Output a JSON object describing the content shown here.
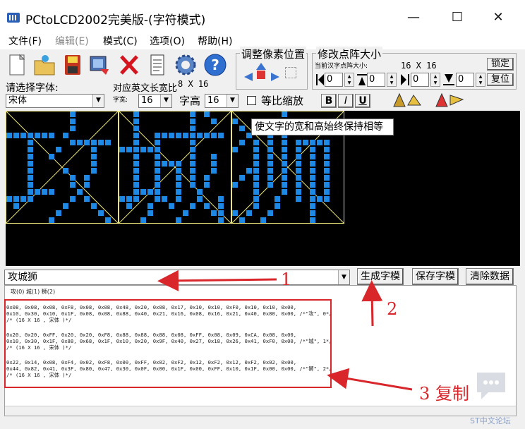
{
  "window": {
    "title": "PCtoLCD2002完美版-(字符模式)",
    "minimize": "—",
    "maximize": "☐",
    "close": "✕"
  },
  "menu": [
    "文件(F)",
    "编辑(E)",
    "模式(C)",
    "选项(O)",
    "帮助(H)"
  ],
  "toolbar": {
    "adjust_title": "调整像素位置",
    "modify_title": "修改点阵大小",
    "current_size_label": "当前汉字点阵大小:",
    "current_size_value": "16 X 16",
    "lock_button": "锁定",
    "restore_button": "复位",
    "spin_values": [
      "0",
      "0",
      "0",
      "0"
    ]
  },
  "font": {
    "select_label": "请选择字体:",
    "ratio_label": "对应英文长宽比",
    "ratio_value": "8 X 16",
    "font_name": "宋体",
    "width_label": "字宽:",
    "width_value": "16",
    "height_label": "字高",
    "height_value": "16",
    "proportional_label": "等比缩放",
    "bold": "B",
    "italic": "I",
    "underline": "U"
  },
  "tooltip": "使文字的宽和高始终保持相等",
  "input": {
    "value": "攻城狮"
  },
  "buttons": {
    "generate": "生成字模",
    "save": "保存字模",
    "clear": "清除数据"
  },
  "output": {
    "header": "攻(0) 城(1) 狮(2)",
    "blocks": [
      [
        "0x08, 0x08, 0x08, 0xF8, 0x08, 0x08, 0x48, 0x20, 0x08, 0x17, 0x10, 0x10, 0xF0, 0x10, 0x10, 0x00,",
        "0x10, 0x30, 0x10, 0x1F, 0x08, 0x08, 0x88, 0x40, 0x21, 0x16, 0x08, 0x16, 0x21, 0x40, 0x80, 0x00, /*\"攻\", 0*/",
        "/* (16 X 16 , 宋体 )*/"
      ],
      [
        "0x20, 0x20, 0xFF, 0x20, 0x20, 0xF8, 0x88, 0x88, 0x88, 0x08, 0xFF, 0x08, 0x09, 0xCA, 0x08, 0x00,",
        "0x10, 0x30, 0x1F, 0x88, 0x68, 0x1F, 0x10, 0x20, 0x9F, 0x40, 0x27, 0x18, 0x26, 0x41, 0xF0, 0x00, /*\"城\", 1*/",
        "/* (16 X 16 , 宋体 )*/"
      ],
      [
        "0x22, 0x14, 0x08, 0xF4, 0x02, 0xF8, 0x00, 0xFF, 0x02, 0xF2, 0x12, 0xF2, 0x12, 0xF2, 0x02, 0x00,",
        "0x44, 0x82, 0x41, 0x3F, 0x80, 0x47, 0x30, 0x0F, 0x00, 0x1F, 0x00, 0xFF, 0x10, 0x1F, 0x00, 0x00, /*\"狮\", 2*/",
        "/* (16 X 16 , 宋体 )*/"
      ]
    ]
  },
  "annotations": {
    "step1": "1",
    "step2": "2",
    "step3": "3 复制"
  },
  "watermark": "ST中文论坛",
  "colors": {
    "pixel": "#1e88e5",
    "grid": "#e8e07a",
    "annotation": "#d9262b"
  }
}
